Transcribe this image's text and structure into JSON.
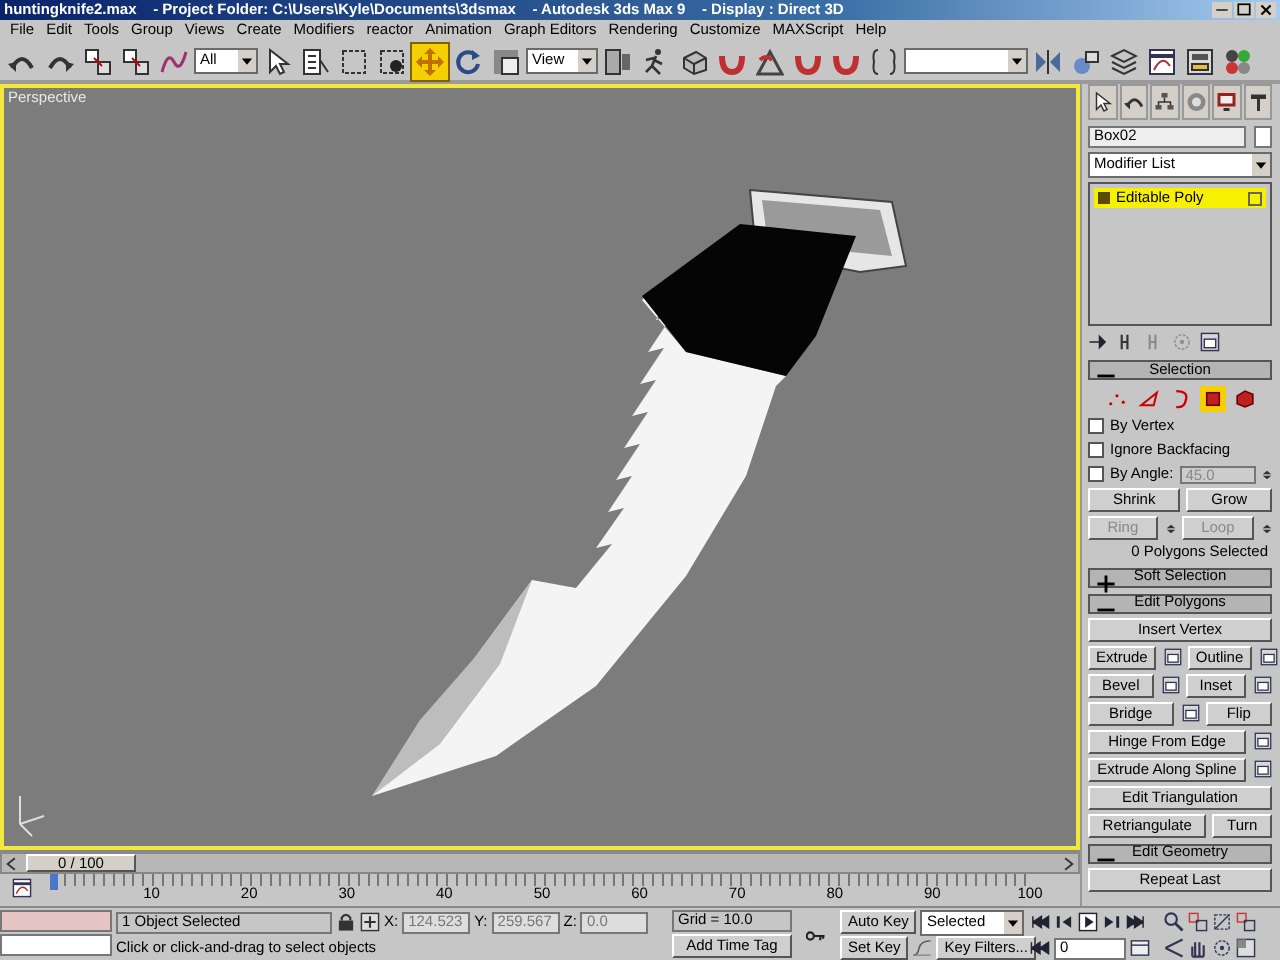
{
  "window": {
    "title": "huntingknife2.max    - Project Folder: C:\\Users\\Kyle\\Documents\\3dsmax    - Autodesk 3ds Max 9    - Display : Direct 3D"
  },
  "menu": [
    "File",
    "Edit",
    "Tools",
    "Group",
    "Views",
    "Create",
    "Modifiers",
    "reactor",
    "Animation",
    "Graph Editors",
    "Rendering",
    "Customize",
    "MAXScript",
    "Help"
  ],
  "toolbar": {
    "selection_filter": "All",
    "reference_coordinate_system": "View",
    "tools": [
      {
        "selected": false
      },
      {
        "selected": false
      },
      {
        "selected": false
      },
      {
        "selected": false
      },
      {
        "selected": false
      },
      {
        "selected": false
      },
      {
        "selected": true
      },
      {
        "selected": false
      },
      {
        "selected": false
      },
      {
        "selected": false
      },
      {
        "selected": false
      }
    ]
  },
  "viewport": {
    "label": "Perspective",
    "active": true
  },
  "command_panel": {
    "object_name": "Box02",
    "modifier_list": "Modifier List",
    "stack": [
      {
        "label": "Editable Poly",
        "selected": true
      }
    ],
    "selection": {
      "title": "Selection",
      "expanded": true,
      "levels": [
        {
          "selected": false
        },
        {
          "selected": false
        },
        {
          "selected": false
        },
        {
          "selected": true
        },
        {
          "selected": false
        }
      ],
      "options": [
        {
          "label": "By Vertex",
          "checked": false
        },
        {
          "label": "Ignore Backfacing",
          "checked": false
        },
        {
          "label": "By Angle:",
          "checked": false,
          "value": "45.0"
        }
      ],
      "buttons": [
        {
          "label": "Shrink",
          "disabled": false,
          "spinner": false
        },
        {
          "label": "Grow",
          "disabled": false,
          "spinner": false
        },
        {
          "label": "Ring",
          "disabled": true,
          "spinner": true
        },
        {
          "label": "Loop",
          "disabled": true,
          "spinner": true
        }
      ],
      "status": "0 Polygons Selected"
    },
    "rollouts": [
      {
        "title": "Soft Selection",
        "expanded": false
      },
      {
        "title": "Edit Polygons",
        "expanded": true,
        "rows": [
          [
            {
              "label": "Insert Vertex",
              "settings": false
            }
          ],
          [
            {
              "label": "Extrude",
              "settings": true
            },
            {
              "label": "Outline",
              "settings": true
            }
          ],
          [
            {
              "label": "Bevel",
              "settings": true
            },
            {
              "label": "Inset",
              "settings": true
            }
          ],
          [
            {
              "label": "Bridge",
              "settings": true
            },
            {
              "label": "Flip",
              "settings": false
            }
          ],
          [
            {
              "label": "Hinge From Edge",
              "settings": true
            }
          ],
          [
            {
              "label": "Extrude Along Spline",
              "settings": true
            }
          ],
          [
            {
              "label": "Edit Triangulation",
              "settings": false
            }
          ],
          [
            {
              "label": "Retriangulate",
              "settings": false
            },
            {
              "label": "Turn",
              "settings": false
            }
          ]
        ]
      },
      {
        "title": "Edit Geometry",
        "expanded": true,
        "rows": [
          [
            {
              "label": "Repeat Last",
              "settings": false
            }
          ]
        ]
      }
    ]
  },
  "timeline": {
    "position": "0 / 100",
    "level": 0,
    "ruler_labels": [
      "10",
      "20",
      "30",
      "40",
      "50",
      "60",
      "70",
      "80",
      "90",
      "100"
    ]
  },
  "status_bar": {
    "selection_count": "1 Object Selected",
    "prompt": "Click or click-and-drag to select objects",
    "coordinates": [
      {
        "label": "X:",
        "value": "124.523"
      },
      {
        "label": "Y:",
        "value": "259.567"
      },
      {
        "label": "Z:",
        "value": "0.0"
      }
    ],
    "grid": "Grid = 10.0",
    "time_tag": "Add Time Tag",
    "auto_key": "Auto Key",
    "set_key": "Set Key",
    "key_mode": "Selected",
    "key_filters": "Key Filters...",
    "frame": "0"
  }
}
